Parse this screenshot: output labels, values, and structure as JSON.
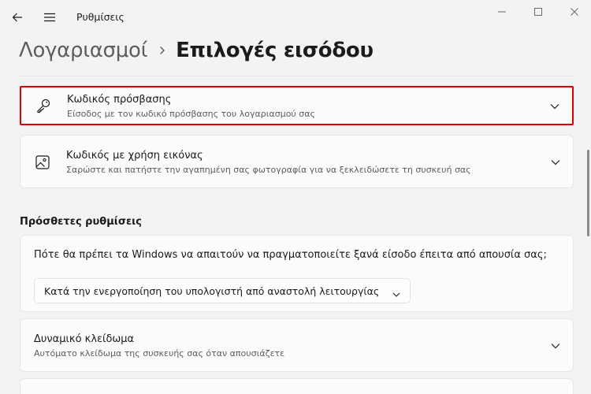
{
  "app": {
    "title": "Ρυθμίσεις"
  },
  "breadcrumb": {
    "parent": "Λογαριασμοί",
    "current": "Επιλογές εισόδου"
  },
  "cards": [
    {
      "title": "Κωδικός πρόσβασης",
      "subtitle": "Είσοδος με τον κωδικό πρόσβασης του λογαριασμού σας",
      "icon": "key-icon"
    },
    {
      "title": "Κωδικός με χρήση εικόνας",
      "subtitle": "Σαρώστε και πατήστε την αγαπημένη σας φωτογραφία για να ξεκλειδώσετε τη συσκευή σας",
      "icon": "picture-icon"
    }
  ],
  "additional": {
    "heading": "Πρόσθετες ρυθμίσεις",
    "signin_question": "Πότε θα πρέπει τα Windows να απαιτούν να πραγματοποιείτε ξανά είσοδο έπειτα από απουσία σας;",
    "signin_dropdown_value": "Κατά την ενεργοποίηση του υπολογιστή από αναστολή λειτουργίας",
    "dynamic_lock": {
      "title": "Δυναμικό κλείδωμα",
      "subtitle": "Αυτόματο κλείδωμα της συσκευής σας όταν απουσιάζετε"
    }
  },
  "colors": {
    "highlight_border": "#e10000",
    "background": "#f3f3f3",
    "card": "#fbfbfb"
  }
}
